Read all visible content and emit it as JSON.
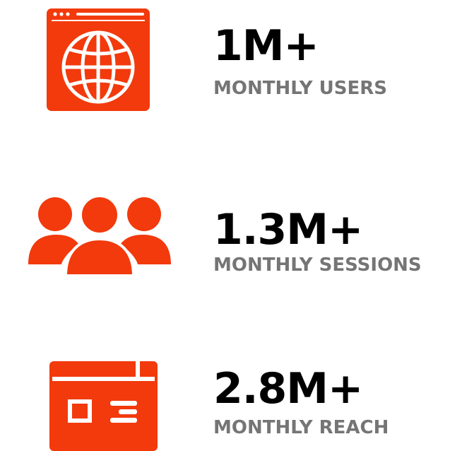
{
  "colors": {
    "accent": "#f23a0c",
    "value_text": "#000000",
    "label_text": "#757575",
    "background": "#ffffff"
  },
  "stats": [
    {
      "icon": "browser-globe-icon",
      "value": "1M+",
      "label": "MONTHLY USERS"
    },
    {
      "icon": "users-group-icon",
      "value": "1.3M+",
      "label": "MONTHLY SESSIONS"
    },
    {
      "icon": "web-page-layout-icon",
      "value": "2.8M+",
      "label": "MONTHLY REACH"
    }
  ]
}
